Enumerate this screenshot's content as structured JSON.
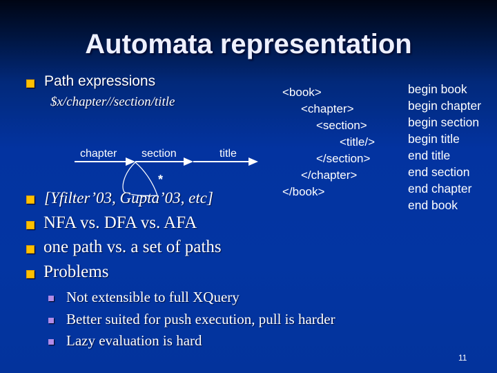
{
  "slide": {
    "title": "Automata representation",
    "page_number": "11",
    "bullets": [
      {
        "text": "Path expressions",
        "style": "sans"
      },
      {
        "text": "[Yfilter’03, Gupta’03, etc]",
        "style": "serif-italic"
      },
      {
        "text": "NFA vs. DFA vs. AFA",
        "style": "serif"
      },
      {
        "text": "one path vs. a set of paths",
        "style": "serif"
      },
      {
        "text": "Problems",
        "style": "serif"
      }
    ],
    "path_expression": "$x/chapter//section/title",
    "automaton": {
      "edges": [
        "chapter",
        "section",
        "title"
      ],
      "self_loop_label": "*"
    },
    "xml_lines": [
      "<book>",
      "<chapter>",
      "<section>",
      "<title/>",
      "</section>",
      "</chapter>",
      "</book>"
    ],
    "events": [
      "begin book",
      "begin chapter",
      "begin section",
      "begin title",
      "end title",
      "end section",
      "end chapter",
      "end book"
    ],
    "problems": [
      "Not extensible to full XQuery",
      "Better suited for push execution, pull is harder",
      "Lazy evaluation is hard"
    ],
    "colors": {
      "bullet": "#ffc000",
      "sub_bullet": "#b08be8",
      "background": "#0333a0"
    }
  }
}
